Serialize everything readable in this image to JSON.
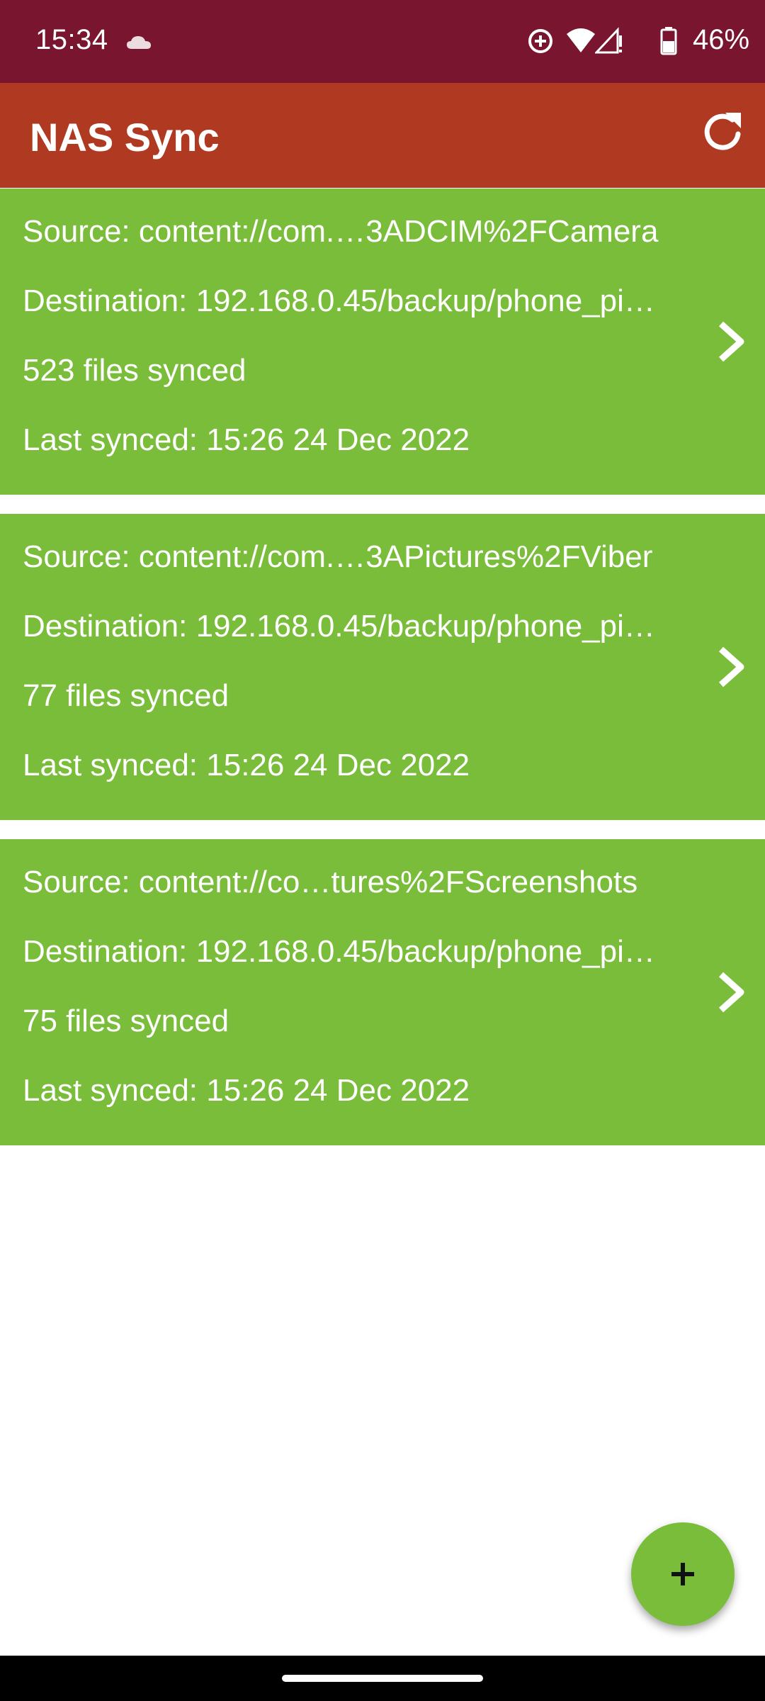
{
  "status_bar": {
    "time": "15:34",
    "battery_percent": "46%",
    "icons": [
      "cloud-icon",
      "data-saver-icon",
      "wifi-icon",
      "signal-icon",
      "battery-icon"
    ]
  },
  "app_bar": {
    "title": "NAS Sync",
    "refresh_icon": "refresh-icon"
  },
  "colors": {
    "status_bar": "#7a1530",
    "app_bar": "#b03a21",
    "card": "#7abd3a",
    "fab": "#7abd3a"
  },
  "syncs": [
    {
      "source": "Source: content://com.…3ADCIM%2FCamera",
      "destination": "Destination: 192.168.0.45/backup/phone_pi…",
      "files": "523 files synced",
      "last_synced": "Last synced: 15:26 24 Dec 2022"
    },
    {
      "source": "Source: content://com.…3APictures%2FViber",
      "destination": "Destination: 192.168.0.45/backup/phone_pi…",
      "files": "77 files synced",
      "last_synced": "Last synced: 15:26 24 Dec 2022"
    },
    {
      "source": "Source: content://co…tures%2FScreenshots",
      "destination": "Destination: 192.168.0.45/backup/phone_pi…",
      "files": "75 files synced",
      "last_synced": "Last synced: 15:26 24 Dec 2022"
    }
  ],
  "fab": {
    "icon": "plus-icon"
  }
}
